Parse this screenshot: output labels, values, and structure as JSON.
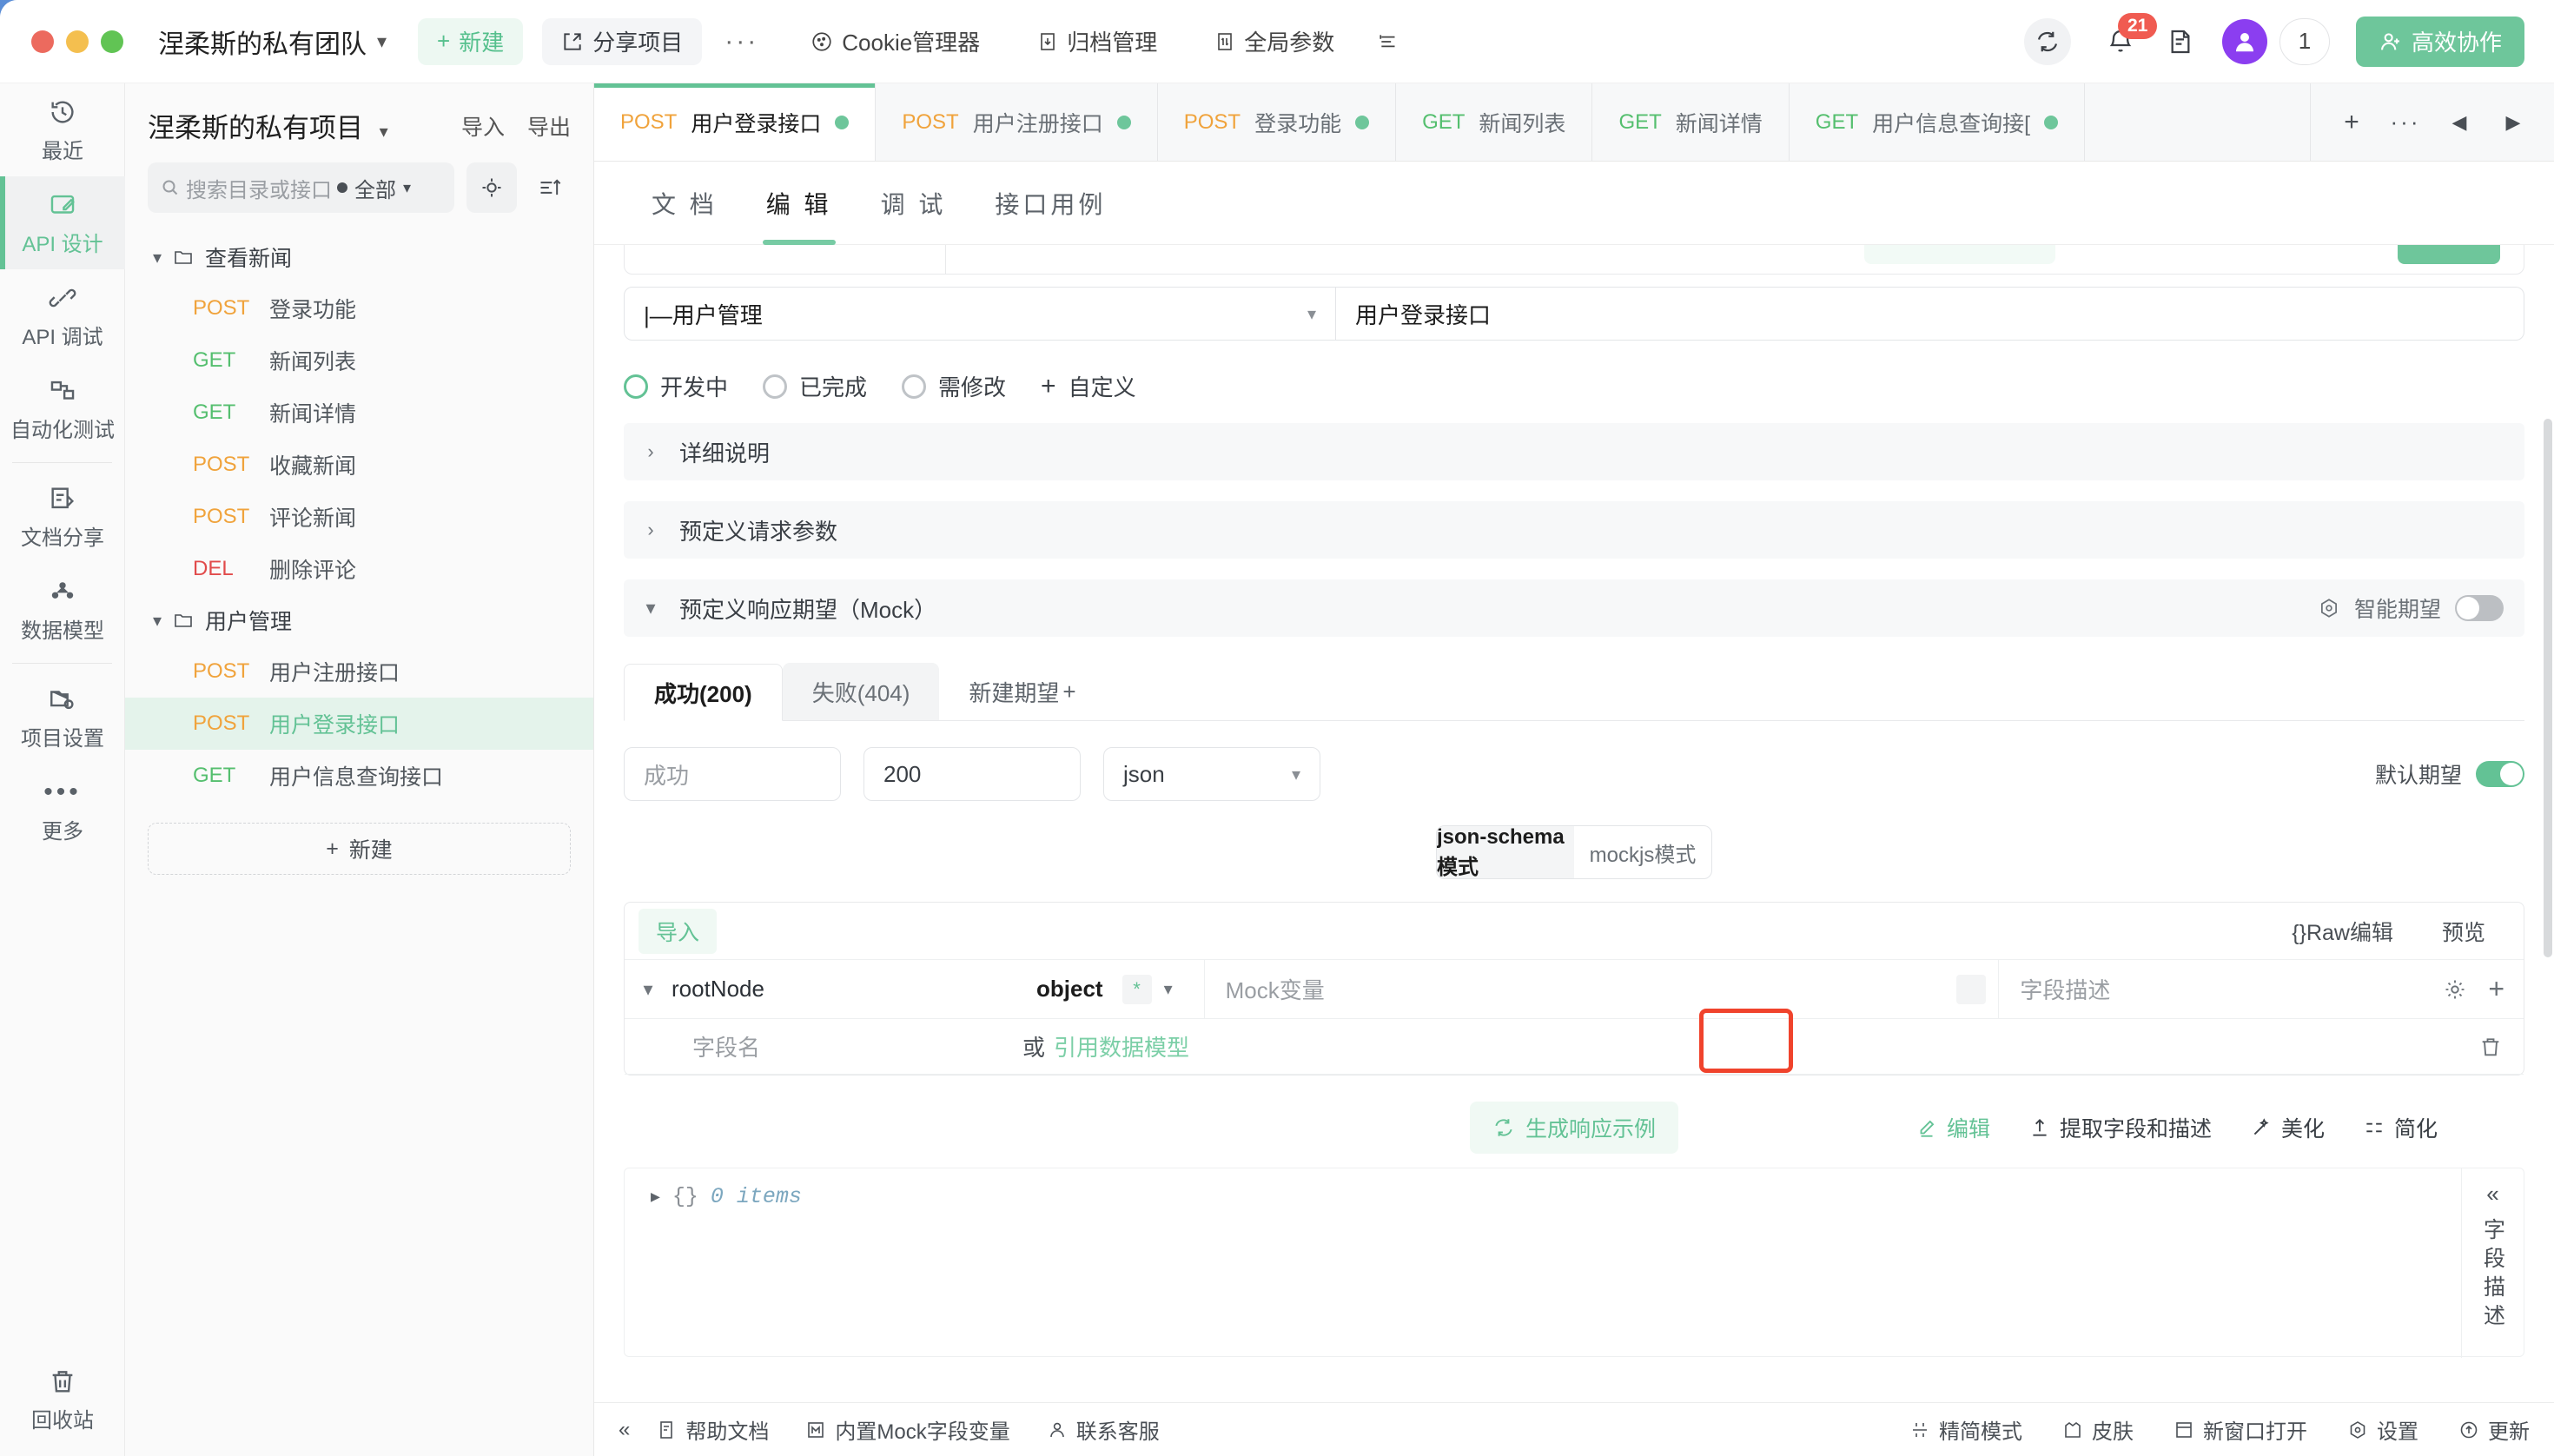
{
  "titlebar": {
    "team_name": "涅柔斯的私有团队",
    "new_label": "新建",
    "share_label": "分享项目",
    "more_label": "···",
    "cookie_label": "Cookie管理器",
    "archive_label": "归档管理",
    "global_params_label": "全局参数",
    "notification_count": "21",
    "user_count": "1",
    "collab_label": "高效协作"
  },
  "rail": {
    "items": [
      {
        "label": "最近",
        "icon": "history-icon",
        "active": false
      },
      {
        "label": "API 设计",
        "icon": "api-design-icon",
        "active": true
      },
      {
        "label": "API 调试",
        "icon": "api-debug-icon",
        "active": false
      },
      {
        "label": "自动化测试",
        "icon": "automation-test-icon",
        "active": false
      },
      {
        "label": "文档分享",
        "icon": "doc-share-icon",
        "active": false
      },
      {
        "label": "数据模型",
        "icon": "data-model-icon",
        "active": false
      },
      {
        "label": "项目设置",
        "icon": "project-settings-icon",
        "active": false
      },
      {
        "label": "更多",
        "icon": "more-icon",
        "active": false
      }
    ],
    "recycle_label": "回收站"
  },
  "project": {
    "title": "涅柔斯的私有项目",
    "import_label": "导入",
    "export_label": "导出",
    "search_placeholder": "搜索目录或接口",
    "scope_label": "全部",
    "new_label": "新建",
    "tree": [
      {
        "type": "folder",
        "label": "查看新闻"
      },
      {
        "type": "api",
        "method": "POST",
        "name": "登录功能",
        "selected": false
      },
      {
        "type": "api",
        "method": "GET",
        "name": "新闻列表",
        "selected": false
      },
      {
        "type": "api",
        "method": "GET",
        "name": "新闻详情",
        "selected": false
      },
      {
        "type": "api",
        "method": "POST",
        "name": "收藏新闻",
        "selected": false
      },
      {
        "type": "api",
        "method": "POST",
        "name": "评论新闻",
        "selected": false
      },
      {
        "type": "api",
        "method": "DEL",
        "name": "删除评论",
        "selected": false
      },
      {
        "type": "folder",
        "label": "用户管理"
      },
      {
        "type": "api",
        "method": "POST",
        "name": "用户注册接口",
        "selected": false
      },
      {
        "type": "api",
        "method": "POST",
        "name": "用户登录接口",
        "selected": true
      },
      {
        "type": "api",
        "method": "GET",
        "name": "用户信息查询接口",
        "selected": false
      }
    ]
  },
  "tabbar": {
    "tabs": [
      {
        "method": "POST",
        "label": "用户登录接口",
        "dot": true,
        "active": true
      },
      {
        "method": "POST",
        "label": "用户注册接口",
        "dot": true,
        "active": false
      },
      {
        "method": "POST",
        "label": "登录功能",
        "dot": true,
        "active": false
      },
      {
        "method": "GET",
        "label": "新闻列表",
        "dot": false,
        "active": false
      },
      {
        "method": "GET",
        "label": "新闻详情",
        "dot": false,
        "active": false
      },
      {
        "method": "GET",
        "label": "用户信息查询接[",
        "dot": true,
        "active": false
      }
    ]
  },
  "subtabs": [
    {
      "label": "文 档",
      "active": false
    },
    {
      "label": "编 辑",
      "active": true
    },
    {
      "label": "调 试",
      "active": false
    },
    {
      "label": "接口用例",
      "active": false
    }
  ],
  "form": {
    "directory_value": "|—用户管理",
    "name_value": "用户登录接口",
    "status": [
      {
        "label": "开发中",
        "checked": true
      },
      {
        "label": "已完成",
        "checked": false
      },
      {
        "label": "需修改",
        "checked": false
      }
    ],
    "custom_label": "自定义"
  },
  "sections": [
    {
      "label": "详细说明",
      "expanded": false
    },
    {
      "label": "预定义请求参数",
      "expanded": false
    },
    {
      "label": "预定义响应期望（Mock）",
      "expanded": true,
      "smart_label": "智能期望",
      "smart_on": false
    }
  ],
  "mock": {
    "expect_tabs": [
      {
        "label": "成功(200)",
        "active": true
      },
      {
        "label": "失败(404)",
        "active": false
      }
    ],
    "new_expect_label": "新建期望",
    "name_value": "成功",
    "code_value": "200",
    "format_value": "json",
    "default_expect_label": "默认期望",
    "default_expect_on": true,
    "mode_json_schema": "json-schema模式",
    "mode_mockjs": "mockjs模式",
    "mode_active": "json-schema模式",
    "import_label": "导入",
    "raw_edit_label": "{}Raw编辑",
    "preview_label": "预览",
    "root_node_name": "rootNode",
    "root_node_type": "object",
    "mock_var_placeholder": "Mock变量",
    "field_desc_placeholder": "字段描述",
    "sub_field_placeholder": "字段名",
    "or_label": "或",
    "ref_model_label": "引用数据模型",
    "generate_label": "生成响应示例",
    "edit_label": "编辑",
    "extract_label": "提取字段和描述",
    "beautify_label": "美化",
    "simplify_label": "简化",
    "editor_braces": "{}",
    "editor_items": "0 items",
    "side_label": "字段描述"
  },
  "bottombar": {
    "left": [
      {
        "label": "帮助文档",
        "icon": "book-icon"
      },
      {
        "label": "内置Mock字段变量",
        "icon": "mock-icon"
      },
      {
        "label": "联系客服",
        "icon": "person-icon"
      }
    ],
    "right": [
      {
        "label": "精简模式",
        "icon": "compact-icon"
      },
      {
        "label": "皮肤",
        "icon": "skin-icon"
      },
      {
        "label": "新窗口打开",
        "icon": "newwindow-icon"
      },
      {
        "label": "设置",
        "icon": "settings-icon"
      },
      {
        "label": "更新",
        "icon": "update-icon"
      }
    ]
  },
  "colors": {
    "accent": "#63c295",
    "post": "#f0a33c",
    "get": "#55bf6f",
    "del": "#e14b4b",
    "highlight": "#f0432c"
  }
}
